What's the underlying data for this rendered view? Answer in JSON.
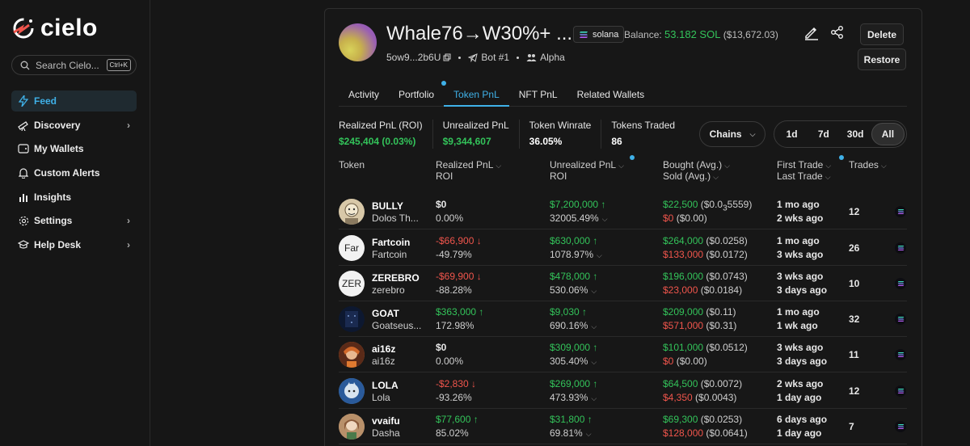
{
  "sidebar": {
    "logo_text": "cielo",
    "search_placeholder": "Search Cielo...",
    "search_shortcut": "Ctrl+K",
    "items": [
      {
        "label": "Feed",
        "icon": "lightning-icon",
        "active": true,
        "has_chevron": false
      },
      {
        "label": "Discovery",
        "icon": "telescope-icon",
        "active": false,
        "has_chevron": true
      },
      {
        "label": "My Wallets",
        "icon": "wallet-icon",
        "active": false,
        "has_chevron": false
      },
      {
        "label": "Custom Alerts",
        "icon": "bell-icon",
        "active": false,
        "has_chevron": false
      },
      {
        "label": "Insights",
        "icon": "bar-chart-icon",
        "active": false,
        "has_chevron": false
      },
      {
        "label": "Settings",
        "icon": "gear-icon",
        "active": false,
        "has_chevron": true
      },
      {
        "label": "Help Desk",
        "icon": "graduation-cap-icon",
        "active": false,
        "has_chevron": true
      }
    ]
  },
  "wallet": {
    "title": "Whale76→W30%+ ...",
    "chain": "solana",
    "balance_label": "Balance:",
    "balance_sol": "53.182 SOL",
    "balance_usd": "($13,672.03)",
    "address": "5ow9...2b6U",
    "bot_label": "Bot #1",
    "group_label": "Alpha",
    "delete_label": "Delete",
    "restore_label": "Restore"
  },
  "tabs": [
    "Activity",
    "Portfolio",
    "Token PnL",
    "NFT PnL",
    "Related Wallets"
  ],
  "active_tab": "Token PnL",
  "stats": [
    {
      "label": "Realized PnL (ROI)",
      "value": "$245,404 (0.03%)",
      "color": "green"
    },
    {
      "label": "Unrealized PnL",
      "value": "$9,344,607",
      "color": "green"
    },
    {
      "label": "Token Winrate",
      "value": "36.05%",
      "color": "white"
    },
    {
      "label": "Tokens Traded",
      "value": "86",
      "color": "white"
    }
  ],
  "chains_label": "Chains",
  "periods": [
    "1d",
    "7d",
    "30d",
    "All"
  ],
  "active_period": "All",
  "columns": {
    "token": "Token",
    "realized": "Realized PnL",
    "realized_sub": "ROI",
    "unrealized": "Unrealized PnL",
    "unrealized_sub": "ROI",
    "bought": "Bought (Avg.)",
    "sold": "Sold (Avg.)",
    "first": "First Trade",
    "last": "Last Trade",
    "trades": "Trades"
  },
  "rows": [
    {
      "symbol": "BULLY",
      "name": "Dolos Th...",
      "avatar": "",
      "avatar_bg": "#d8c8a8",
      "realized": "$0",
      "realized_color": "white",
      "realized_arrow": "",
      "realized_roi": "0.00%",
      "unrealized": "$7,200,000",
      "unrealized_arrow": "↑",
      "unrealized_roi": "32005.49%",
      "bought": "$22,500",
      "bought_avg": "($0.0",
      "bought_avg_sub": "3",
      "bought_avg_tail": "5559)",
      "sold": "$0",
      "sold_avg": "($0.00)",
      "first": "1 mo ago",
      "last": "2 wks ago",
      "trades": "12"
    },
    {
      "symbol": "Fartcoin",
      "name": "Fartcoin",
      "avatar": "Far",
      "avatar_bg": "#f2f2f2",
      "realized": "-$66,900",
      "realized_color": "red",
      "realized_arrow": "↓",
      "realized_roi": "-49.79%",
      "unrealized": "$630,000",
      "unrealized_arrow": "↑",
      "unrealized_roi": "1078.97%",
      "bought": "$264,000",
      "bought_avg": "($0.0258)",
      "bought_avg_sub": "",
      "bought_avg_tail": "",
      "sold": "$133,000",
      "sold_avg": "($0.0172)",
      "first": "1 mo ago",
      "last": "3 wks ago",
      "trades": "26"
    },
    {
      "symbol": "ZEREBRO",
      "name": "zerebro",
      "avatar": "ZER",
      "avatar_bg": "#f2f2f2",
      "realized": "-$69,900",
      "realized_color": "red",
      "realized_arrow": "↓",
      "realized_roi": "-88.28%",
      "unrealized": "$478,000",
      "unrealized_arrow": "↑",
      "unrealized_roi": "530.06%",
      "bought": "$196,000",
      "bought_avg": "($0.0743)",
      "bought_avg_sub": "",
      "bought_avg_tail": "",
      "sold": "$23,000",
      "sold_avg": "($0.0184)",
      "first": "3 wks ago",
      "last": "3 days ago",
      "trades": "10"
    },
    {
      "symbol": "GOAT",
      "name": "Goatseus...",
      "avatar": "",
      "avatar_bg": "#0d1830",
      "realized": "$363,000",
      "realized_color": "green",
      "realized_arrow": "↑",
      "realized_roi": "172.98%",
      "unrealized": "$9,030",
      "unrealized_arrow": "↑",
      "unrealized_roi": "690.16%",
      "bought": "$209,000",
      "bought_avg": "($0.11)",
      "bought_avg_sub": "",
      "bought_avg_tail": "",
      "sold": "$571,000",
      "sold_avg": "($0.31)",
      "first": "1 mo ago",
      "last": "1 wk ago",
      "trades": "32"
    },
    {
      "symbol": "ai16z",
      "name": "ai16z",
      "avatar": "",
      "avatar_bg": "#c8602a",
      "realized": "$0",
      "realized_color": "white",
      "realized_arrow": "",
      "realized_roi": "0.00%",
      "unrealized": "$309,000",
      "unrealized_arrow": "↑",
      "unrealized_roi": "305.40%",
      "bought": "$101,000",
      "bought_avg": "($0.0512)",
      "bought_avg_sub": "",
      "bought_avg_tail": "",
      "sold": "$0",
      "sold_avg": "($0.00)",
      "first": "3 wks ago",
      "last": "3 days ago",
      "trades": "11"
    },
    {
      "symbol": "LOLA",
      "name": "Lola",
      "avatar": "",
      "avatar_bg": "#4a7fb8",
      "realized": "-$2,830",
      "realized_color": "red",
      "realized_arrow": "↓",
      "realized_roi": "-93.26%",
      "unrealized": "$269,000",
      "unrealized_arrow": "↑",
      "unrealized_roi": "473.93%",
      "bought": "$64,500",
      "bought_avg": "($0.0072)",
      "bought_avg_sub": "",
      "bought_avg_tail": "",
      "sold": "$4,350",
      "sold_avg": "($0.0043)",
      "first": "2 wks ago",
      "last": "1 day ago",
      "trades": "12"
    },
    {
      "symbol": "vvaifu",
      "name": "Dasha",
      "avatar": "",
      "avatar_bg": "#c9a27a",
      "realized": "$77,600",
      "realized_color": "green",
      "realized_arrow": "↑",
      "realized_roi": "85.02%",
      "unrealized": "$31,800",
      "unrealized_arrow": "↑",
      "unrealized_roi": "69.81%",
      "bought": "$69,300",
      "bought_avg": "($0.0253)",
      "bought_avg_sub": "",
      "bought_avg_tail": "",
      "sold": "$128,000",
      "sold_avg": "($0.0641)",
      "first": "6 days ago",
      "last": "1 day ago",
      "trades": "7"
    }
  ],
  "colors": {
    "accent": "#3fb1e8",
    "green": "#33c35a",
    "red": "#f0554c",
    "bg": "#161616"
  }
}
